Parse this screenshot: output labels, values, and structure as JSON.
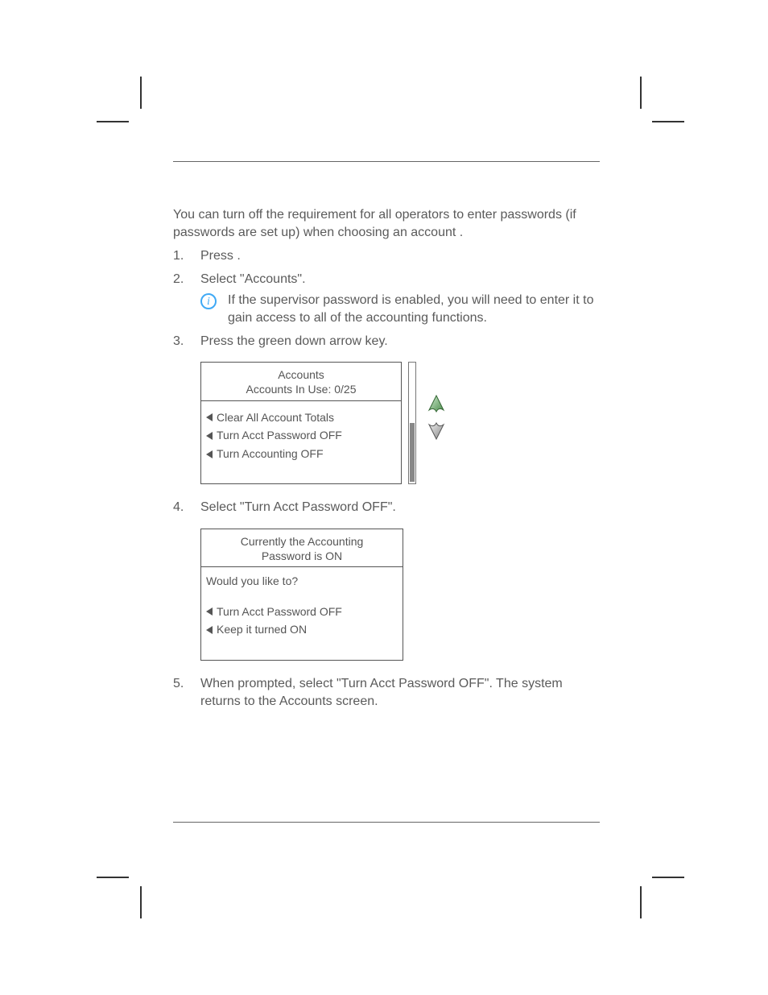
{
  "intro": "You can turn off the requirement for all operators to enter passwords (if passwords are set up) when choosing an account .",
  "steps": {
    "s1_a": "Press ",
    "s1_b": ".",
    "s2": "Select \"Accounts\".",
    "note_label": "i",
    "note": "If the supervisor password is enabled, you will need to enter it to gain access to all of the accounting functions.",
    "s3": "Press the green down arrow key.",
    "s4": "Select \"Turn Acct Password OFF\".",
    "s5": "When prompted, select \"Turn Acct Password OFF\". The system returns to the Accounts screen."
  },
  "screen1": {
    "title1": "Accounts",
    "title2": "Accounts In Use:  0/25",
    "items": [
      "Clear All Account Totals",
      "Turn Acct Password OFF",
      "Turn Accounting OFF"
    ]
  },
  "screen2": {
    "title1": "Currently the Accounting",
    "title2": "Password is ON",
    "prompt": "Would you like to?",
    "items": [
      "Turn Acct Password OFF",
      "Keep it turned ON"
    ]
  }
}
